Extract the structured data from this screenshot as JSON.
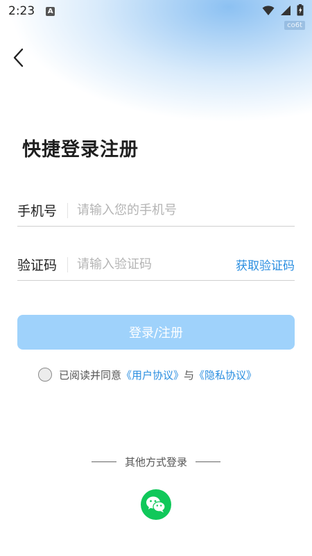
{
  "status_bar": {
    "time": "2:23",
    "notification_badge": "A",
    "device_tag": "co6t"
  },
  "header": {
    "title": "快捷登录注册"
  },
  "phone_field": {
    "label": "手机号",
    "placeholder": "请输入您的手机号",
    "value": ""
  },
  "code_field": {
    "label": "验证码",
    "placeholder": "请输入验证码",
    "value": "",
    "get_code_label": "获取验证码"
  },
  "submit": {
    "label": "登录/注册"
  },
  "agreement": {
    "prefix": "已阅读并同意",
    "user_agreement": "《用户协议》",
    "conjunction": "与",
    "privacy_policy": "《隐私协议》"
  },
  "other_login": {
    "label": "其他方式登录"
  },
  "colors": {
    "accent": "#2a8ee0",
    "button_bg": "#9fd2fb",
    "wechat": "#10c85a"
  }
}
